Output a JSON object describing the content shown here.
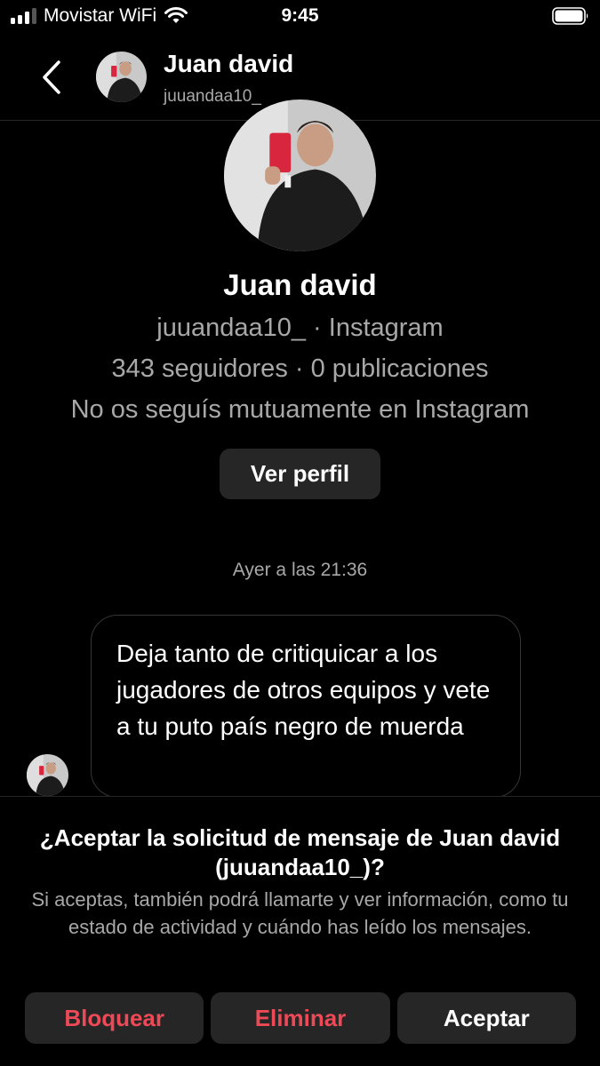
{
  "status_bar": {
    "carrier": "Movistar WiFi",
    "time": "9:45"
  },
  "header": {
    "name": "Juan david",
    "username": "juuandaa10_"
  },
  "profile": {
    "name": "Juan david",
    "handle_line": "juuandaa10_ · Instagram",
    "stats_line": "343 seguidores · 0 publicaciones",
    "mutual_line": "No os seguís mutuamente en Instagram",
    "view_profile_label": "Ver perfil"
  },
  "conversation": {
    "timestamp": "Ayer a las 21:36",
    "messages": [
      {
        "text": "Deja tanto de critiquicar a los jugadores de otros equipos y vete a tu puto país negro de muerda"
      }
    ]
  },
  "request": {
    "title": "¿Aceptar la solicitud de mensaje de Juan david (juuandaa10_)?",
    "description": "Si aceptas, también podrá llamarte y ver información, como tu estado de actividad y cuándo has leído los mensajes.",
    "block_label": "Bloquear",
    "delete_label": "Eliminar",
    "accept_label": "Aceptar"
  },
  "colors": {
    "background": "#000000",
    "secondary_text": "#a8a8a8",
    "button_bg": "#262626",
    "danger": "#ed4956"
  },
  "icons": [
    "signal-icon",
    "wifi-icon",
    "battery-icon",
    "back-chevron-icon"
  ]
}
